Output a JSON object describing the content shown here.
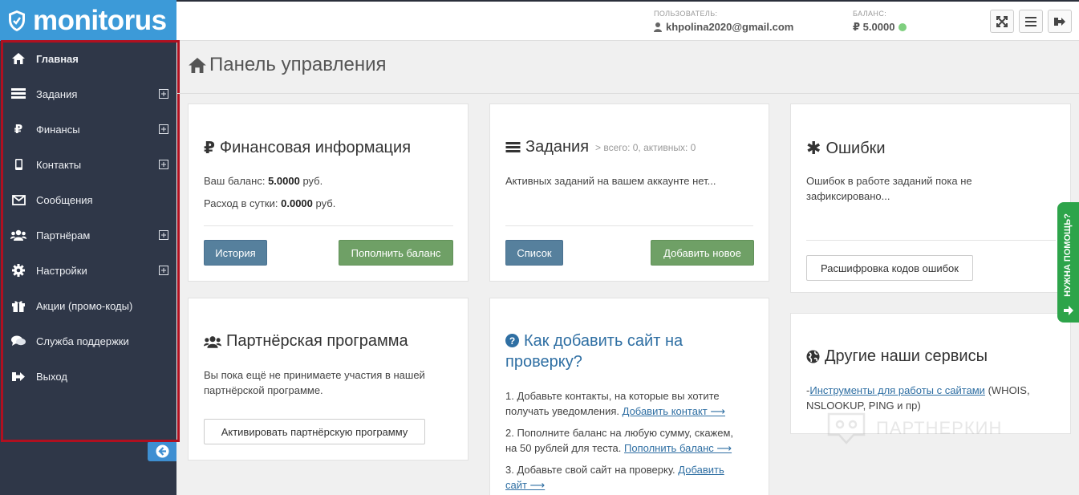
{
  "brand": {
    "name": "monitorus",
    "color": "#3c9ad8"
  },
  "header": {
    "user_label": "ПОЛЬЗОВАТЕЛЬ:",
    "user_value": "khpolina2020@gmail.com",
    "balance_label": "БАЛАНС:",
    "balance_value": "₽ 5.0000",
    "buttons": [
      "fullscreen-icon",
      "menu-icon",
      "logout-icon"
    ]
  },
  "sidebar": {
    "items": [
      {
        "label": "Главная",
        "icon": "home-icon",
        "active": true
      },
      {
        "label": "Задания",
        "icon": "tasks-icon",
        "expandable": true
      },
      {
        "label": "Финансы",
        "icon": "ruble-icon",
        "expandable": true
      },
      {
        "label": "Контакты",
        "icon": "mobile-icon",
        "expandable": true
      },
      {
        "label": "Сообщения",
        "icon": "envelope-icon"
      },
      {
        "label": "Партнёрам",
        "icon": "users-icon",
        "expandable": true
      },
      {
        "label": "Настройки",
        "icon": "gear-icon",
        "expandable": true
      },
      {
        "label": "Акции (промо-коды)",
        "icon": "gift-icon"
      },
      {
        "label": "Служба поддержки",
        "icon": "chat-icon"
      },
      {
        "label": "Выход",
        "icon": "signout-icon"
      }
    ],
    "collapse_icon": "arrow-left-circle-icon"
  },
  "page": {
    "title": "Панель управления"
  },
  "cards": {
    "finance": {
      "title": "Финансовая информация",
      "balance_prefix": "Ваш баланс:",
      "balance_value": "5.0000",
      "balance_unit": "руб.",
      "daily_prefix": "Расход в сутки:",
      "daily_value": "0.0000",
      "daily_unit": "руб.",
      "btn_history": "История",
      "btn_topup": "Пополнить баланс"
    },
    "tasks": {
      "title": "Задания",
      "subtitle": "> всего: 0, активных: 0",
      "text": "Активных заданий на вашем аккаунте нет...",
      "btn_list": "Список",
      "btn_add": "Добавить новое"
    },
    "errors": {
      "title": "Ошибки",
      "text_line1": "Ошибок в работе заданий пока не",
      "text_line2": "зафиксировано...",
      "btn_codes": "Расшифровка кодов ошибок"
    },
    "partner": {
      "title": "Партнёрская программа",
      "text_line1": "Вы пока ещё не принимаете участия в нашей",
      "text_line2": "партнёрской программе.",
      "btn_activate": "Активировать партнёрскую программу"
    },
    "howto": {
      "title_line1": "Как добавить сайт на",
      "title_line2": "проверку?",
      "step1_line1": "1. Добавьте контакты, на которые вы хотите",
      "step1_line2": "получать уведомления.",
      "step1_link": "Добавить контакт ⟶",
      "step2_line1": "2. Пополните баланс на любую сумму, скажем,",
      "step2_line2": "на 50 рублей для теста.",
      "step2_link": "Пополнить баланс ⟶",
      "step3_line1": "3. Добавьте свой сайт на проверку.",
      "step3_link1": "Добавить",
      "step3_link2": "сайт ⟶"
    },
    "services": {
      "title": "Другие наши сервисы",
      "dash": "-",
      "link": "Инструменты для работы с сайтами",
      "text_line1": "(WHOIS,",
      "text_line2": "NSLOOKUP, PING и пр)"
    }
  },
  "help_tab": {
    "label": "НУЖНА ПОМОЩЬ?",
    "color": "#2da44a"
  },
  "watermark": {
    "text": "ПАРТНЕРКИН"
  }
}
